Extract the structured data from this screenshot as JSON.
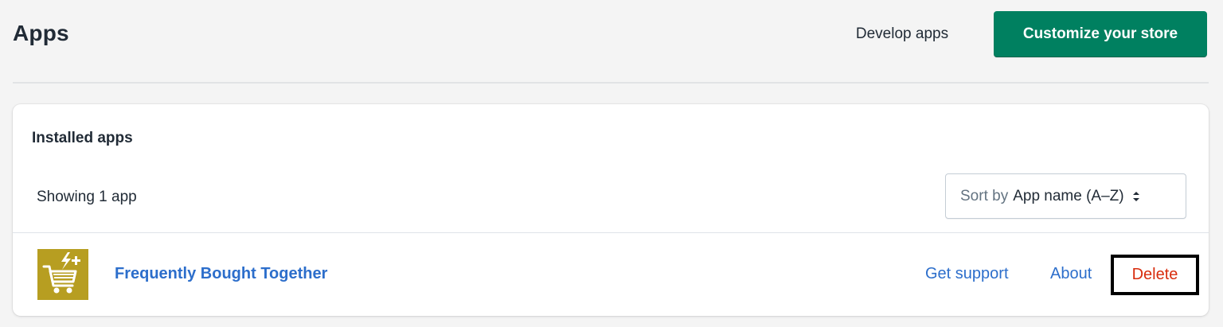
{
  "header": {
    "title": "Apps",
    "develop_label": "Develop apps",
    "customize_label": "Customize your store"
  },
  "installed": {
    "title": "Installed apps",
    "showing": "Showing 1 app",
    "sort": {
      "prefix": "Sort by",
      "value": "App name (A–Z)"
    }
  },
  "apps": [
    {
      "name": "Frequently Bought Together",
      "icon": "cart-plus-icon",
      "icon_bg": "#b79e21",
      "actions": {
        "support": "Get support",
        "about": "About",
        "delete": "Delete"
      }
    }
  ],
  "colors": {
    "primary": "#008060",
    "link": "#2c6ecb",
    "destructive": "#d82c0d",
    "background": "#f4f4f4"
  }
}
